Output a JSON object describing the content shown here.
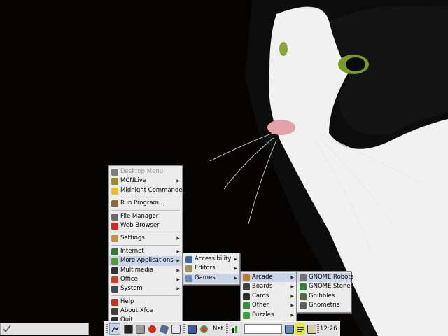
{
  "desktop_menu": {
    "items": [
      {
        "label": "Desktop Menu",
        "icon": "desktop-menu-icon",
        "color": "#7d7d7d",
        "disabled": true
      },
      {
        "label": "MCNLive",
        "icon": "leaf-icon",
        "color": "#9c8a2e",
        "submenu": true
      },
      {
        "label": "Midnight Commander",
        "icon": "smiley-icon",
        "color": "#e8c020"
      },
      {
        "sep": true
      },
      {
        "label": "Run Program...",
        "icon": "run-icon",
        "color": "#8a6a3a"
      },
      {
        "sep": true
      },
      {
        "label": "File Manager",
        "icon": "file-manager-icon",
        "color": "#6a6a6a"
      },
      {
        "label": "Web Browser",
        "icon": "web-browser-icon",
        "color": "#d02a1c"
      },
      {
        "sep": true
      },
      {
        "label": "Settings",
        "icon": "wrench-icon",
        "color": "#c89040",
        "submenu": true
      },
      {
        "sep": true
      },
      {
        "label": "Internet",
        "icon": "globe-icon",
        "color": "#2a7a3a",
        "submenu": true
      },
      {
        "label": "More Applications",
        "icon": "more-applications-icon",
        "color": "#5a9a3a",
        "submenu": true,
        "highlighted": true
      },
      {
        "label": "Multimedia",
        "icon": "multimedia-icon",
        "color": "#303030",
        "submenu": true
      },
      {
        "label": "Office",
        "icon": "office-icon",
        "color": "#d04020",
        "submenu": true
      },
      {
        "label": "System",
        "icon": "system-icon",
        "color": "#404a60",
        "submenu": true
      },
      {
        "sep": true
      },
      {
        "label": "Help",
        "icon": "help-icon",
        "color": "#c83020"
      },
      {
        "label": "About Xfce",
        "icon": "about-icon",
        "color": "#404040"
      },
      {
        "label": "Quit",
        "icon": "quit-icon",
        "color": "#303030"
      }
    ]
  },
  "more_applications_menu": {
    "items": [
      {
        "label": "Accessibility",
        "icon": "accessibility-icon",
        "color": "#3a6ab0",
        "submenu": true
      },
      {
        "label": "Editors",
        "icon": "editors-icon",
        "color": "#a09060",
        "submenu": true
      },
      {
        "label": "Games",
        "icon": "games-icon",
        "color": "#6a8ab0",
        "submenu": true,
        "highlighted": true
      }
    ]
  },
  "games_menu": {
    "items": [
      {
        "label": "Arcade",
        "icon": "arcade-icon",
        "color": "#c07a30",
        "submenu": true,
        "highlighted": true
      },
      {
        "label": "Boards",
        "icon": "boards-icon",
        "color": "#404040",
        "submenu": true
      },
      {
        "label": "Cards",
        "icon": "cards-icon",
        "color": "#303030",
        "submenu": true
      },
      {
        "label": "Other",
        "icon": "other-icon",
        "color": "#3a8a3a",
        "submenu": true
      },
      {
        "label": "Puzzles",
        "icon": "puzzles-icon",
        "color": "#40a040",
        "submenu": true
      }
    ]
  },
  "arcade_menu": {
    "items": [
      {
        "label": "GNOME Robots",
        "icon": "robots-icon",
        "color": "#707070",
        "highlighted": true
      },
      {
        "label": "GNOME Stones",
        "icon": "stones-icon",
        "color": "#3a7a3a"
      },
      {
        "label": "Gnibbles",
        "icon": "gnibbles-icon",
        "color": "#5a6a3a"
      },
      {
        "label": "Gnometris",
        "icon": "gnometris-icon",
        "color": "#606060"
      }
    ]
  },
  "taskbar": {
    "net_label": "Net",
    "clock": "12:26",
    "launcher_value": ""
  }
}
